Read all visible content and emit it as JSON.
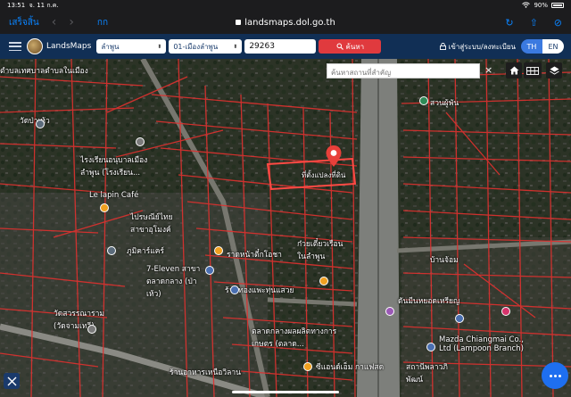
{
  "status_bar": {
    "time": "13:51",
    "date": "จ. 11 ก.ค.",
    "battery": "90%"
  },
  "safari": {
    "done_label": "เสร็จสิ้น",
    "text_size_label": "กก",
    "url": "landsmaps.dol.go.th"
  },
  "app": {
    "brand": "LandsMaps",
    "province": "ลำพูน",
    "district": "01-เมืองลำพูน",
    "parcel_number": "29263",
    "search_button": "ค้นหา",
    "login_label": "เข้าสู่ระบบ/ลงทะเบียน",
    "lang_th": "TH",
    "lang_en": "EN"
  },
  "map": {
    "place_search_placeholder": "ค้นหาสถานที่สำคัญ",
    "close_symbol": "×",
    "selected_parcel_label": "ที่ตั้งแปลงที่ดิน",
    "labels": [
      "ตำบลเทศบาลตำบลในเมือง",
      "วัดป่าเห้ว",
      "ไรงเรียนอนุบาลเมืองลำพูน (โรงเรียน...",
      "Le lapin Café",
      "ไปรษณีย์ไทย สาขาอุโมงค์",
      "ภูมิคาร์แคร์",
      "7-Eleven สาขาตลาดกลาง (ป่าเห้ว)",
      "ราดหน้าตี๋กโอชา",
      "ก๋วยเตี๋ยวเรือนในลำพูน",
      "ร้านทองแพะทุ่นแสวย",
      "ตลาดกลางผลผลิตทางการเกษตร (ตลาด...",
      "ดันมีนหยอดเหรียญ",
      "Mazda Chiangmai Co., Ltd (Lampoon Branch)",
      "ซีแอนด์เอ็ม กาแฟสด",
      "วัดสวรรณาราม (วัดจามเทวี)",
      "สวนผู้พัน",
      "บ้านจ้อม",
      "สถานีพลาวภิพัฒน์",
      "ร้านอาหารเหนือวิลาน"
    ]
  }
}
